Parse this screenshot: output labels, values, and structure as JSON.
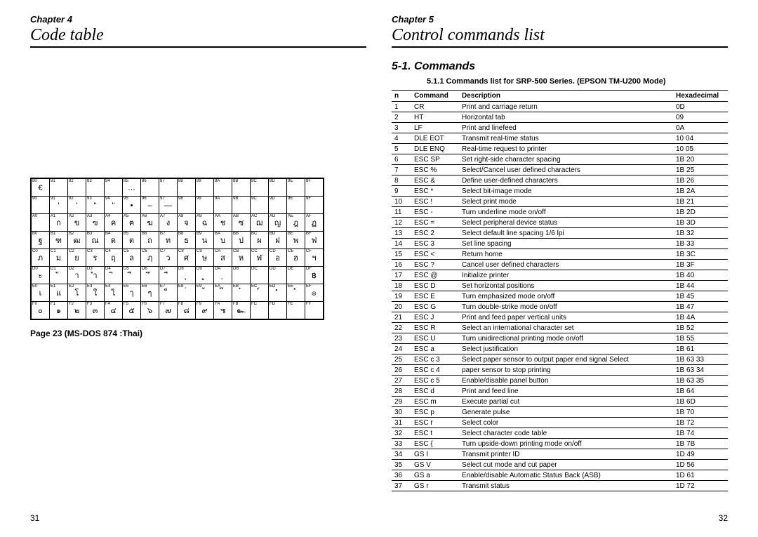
{
  "left": {
    "chapter": "Chapter 4",
    "title": "Code table",
    "caption": "Page 23 (MS-DOS 874 :Thai)",
    "page_num": "31",
    "code_rows": [
      [
        [
          "80",
          "€"
        ],
        [
          "81",
          ""
        ],
        [
          "82",
          ""
        ],
        [
          "83",
          ""
        ],
        [
          "84",
          ""
        ],
        [
          "85",
          "…"
        ],
        [
          "86",
          ""
        ],
        [
          "87",
          ""
        ],
        [
          "88",
          ""
        ],
        [
          "89",
          ""
        ],
        [
          "8A",
          ""
        ],
        [
          "8B",
          ""
        ],
        [
          "8C",
          ""
        ],
        [
          "8D",
          ""
        ],
        [
          "8E",
          ""
        ],
        [
          "8F",
          ""
        ]
      ],
      [
        [
          "90",
          ""
        ],
        [
          "91",
          "'"
        ],
        [
          "92",
          "'"
        ],
        [
          "93",
          "\""
        ],
        [
          "94",
          "\""
        ],
        [
          "95",
          "•"
        ],
        [
          "96",
          "–"
        ],
        [
          "97",
          "—"
        ],
        [
          "98",
          ""
        ],
        [
          "99",
          ""
        ],
        [
          "9A",
          ""
        ],
        [
          "9B",
          ""
        ],
        [
          "9C",
          ""
        ],
        [
          "9D",
          ""
        ],
        [
          "9E",
          ""
        ],
        [
          "9F",
          ""
        ]
      ],
      [
        [
          "A0",
          ""
        ],
        [
          "A1",
          "ก"
        ],
        [
          "A2",
          "ข"
        ],
        [
          "A3",
          "ฃ"
        ],
        [
          "A4",
          "ค"
        ],
        [
          "A5",
          "ฅ"
        ],
        [
          "A6",
          "ฆ"
        ],
        [
          "A7",
          "ง"
        ],
        [
          "A8",
          "จ"
        ],
        [
          "A9",
          "ฉ"
        ],
        [
          "AA",
          "ช"
        ],
        [
          "AB",
          "ซ"
        ],
        [
          "AC",
          "ฌ"
        ],
        [
          "AD",
          "ญ"
        ],
        [
          "AE",
          "ฎ"
        ],
        [
          "AF",
          "ฏ"
        ]
      ],
      [
        [
          "B0",
          "ฐ"
        ],
        [
          "B1",
          "ฑ"
        ],
        [
          "B2",
          "ฒ"
        ],
        [
          "B3",
          "ณ"
        ],
        [
          "B4",
          "ด"
        ],
        [
          "B5",
          "ต"
        ],
        [
          "B6",
          "ถ"
        ],
        [
          "B7",
          "ท"
        ],
        [
          "B8",
          "ธ"
        ],
        [
          "B9",
          "น"
        ],
        [
          "BA",
          "บ"
        ],
        [
          "BB",
          "ป"
        ],
        [
          "BC",
          "ผ"
        ],
        [
          "BD",
          "ฝ"
        ],
        [
          "BE",
          "พ"
        ],
        [
          "BF",
          "ฟ"
        ]
      ],
      [
        [
          "C0",
          "ภ"
        ],
        [
          "C1",
          "ม"
        ],
        [
          "C2",
          "ย"
        ],
        [
          "C3",
          "ร"
        ],
        [
          "C4",
          "ฤ"
        ],
        [
          "C5",
          "ล"
        ],
        [
          "C6",
          "ฦ"
        ],
        [
          "C7",
          "ว"
        ],
        [
          "C8",
          "ศ"
        ],
        [
          "C9",
          "ษ"
        ],
        [
          "CA",
          "ส"
        ],
        [
          "CB",
          "ห"
        ],
        [
          "CC",
          "ฬ"
        ],
        [
          "CD",
          "อ"
        ],
        [
          "CE",
          "ฮ"
        ],
        [
          "CF",
          "ฯ"
        ]
      ],
      [
        [
          "D0",
          "ะ"
        ],
        [
          "D1",
          " ั"
        ],
        [
          "D2",
          "า"
        ],
        [
          "D3",
          "ำ"
        ],
        [
          "D4",
          " ิ"
        ],
        [
          "D5",
          " ี"
        ],
        [
          "D6",
          " ึ"
        ],
        [
          "D7",
          " ื"
        ],
        [
          "D8",
          " ุ"
        ],
        [
          "D9",
          " ู"
        ],
        [
          "DA",
          " ฺ"
        ],
        [
          "DB",
          ""
        ],
        [
          "DC",
          ""
        ],
        [
          "DD",
          ""
        ],
        [
          "DE",
          ""
        ],
        [
          "DF",
          "฿"
        ]
      ],
      [
        [
          "E0",
          "เ"
        ],
        [
          "E1",
          "แ"
        ],
        [
          "E2",
          "โ"
        ],
        [
          "E3",
          "ใ"
        ],
        [
          "E4",
          "ไ"
        ],
        [
          "E5",
          "ๅ"
        ],
        [
          "E6",
          "ๆ"
        ],
        [
          "E7",
          " ็"
        ],
        [
          "E8",
          " ่"
        ],
        [
          "E9",
          " ้"
        ],
        [
          "EA",
          " ๊"
        ],
        [
          "EB",
          " ๋"
        ],
        [
          "EC",
          " ์"
        ],
        [
          "ED",
          " ํ"
        ],
        [
          "EE",
          " ๎"
        ],
        [
          "EF",
          "๏"
        ]
      ],
      [
        [
          "F0",
          "๐"
        ],
        [
          "F1",
          "๑"
        ],
        [
          "F2",
          "๒"
        ],
        [
          "F3",
          "๓"
        ],
        [
          "F4",
          "๔"
        ],
        [
          "F5",
          "๕"
        ],
        [
          "F6",
          "๖"
        ],
        [
          "F7",
          "๗"
        ],
        [
          "F8",
          "๘"
        ],
        [
          "F9",
          "๙"
        ],
        [
          "FA",
          "๚"
        ],
        [
          "FB",
          "๛"
        ],
        [
          "FC",
          ""
        ],
        [
          "FD",
          ""
        ],
        [
          "FE",
          ""
        ],
        [
          "FF",
          ""
        ]
      ]
    ]
  },
  "right": {
    "chapter": "Chapter 5",
    "title": "Control commands list",
    "section": "5-1. Commands",
    "subsection": "5.1.1 Commands list for SRP-500 Series. (EPSON TM-U200 Mode)",
    "page_num": "32",
    "headers": {
      "n": "n",
      "cmd": "Command",
      "desc": "Description",
      "hex": "Hexadecimal"
    },
    "rows": [
      {
        "n": "1",
        "cmd": "CR",
        "desc": "Print and carriage return",
        "hex": "0D"
      },
      {
        "n": "2",
        "cmd": "HT",
        "desc": "Horizontal tab",
        "hex": "09"
      },
      {
        "n": "3",
        "cmd": "LF",
        "desc": "Print and linefeed",
        "hex": "0A"
      },
      {
        "n": "4",
        "cmd": "DLE EOT",
        "desc": "Transmit real-time status",
        "hex": "10 04"
      },
      {
        "n": "5",
        "cmd": "DLE ENQ",
        "desc": "Real-time request to printer",
        "hex": "10 05"
      },
      {
        "n": "6",
        "cmd": "ESC SP",
        "desc": "Set right-side character spacing",
        "hex": "1B 20"
      },
      {
        "n": "7",
        "cmd": "ESC %",
        "desc": "Select/Cancel user defined characters",
        "hex": "1B 25"
      },
      {
        "n": "8",
        "cmd": "ESC &",
        "desc": "Define user-defined characters",
        "hex": "1B 26"
      },
      {
        "n": "9",
        "cmd": "ESC *",
        "desc": "Select bit-image mode",
        "hex": "1B 2A"
      },
      {
        "n": "10",
        "cmd": "ESC !",
        "desc": "Select print mode",
        "hex": "1B 21"
      },
      {
        "n": "11",
        "cmd": "ESC -",
        "desc": "Turn underline mode on/off",
        "hex": "1B 2D"
      },
      {
        "n": "12",
        "cmd": "ESC =",
        "desc": "Select peripheral device status",
        "hex": "1B 3D"
      },
      {
        "n": "13",
        "cmd": "ESC 2",
        "desc": "Select default line spacing 1/6 lpi",
        "hex": "1B 32"
      },
      {
        "n": "14",
        "cmd": "ESC 3",
        "desc": "Set line spacing",
        "hex": "1B 33"
      },
      {
        "n": "15",
        "cmd": "ESC <",
        "desc": "Return home",
        "hex": "1B 3C"
      },
      {
        "n": "16",
        "cmd": "ESC ?",
        "desc": "Cancel user defined characters",
        "hex": "1B 3F"
      },
      {
        "n": "17",
        "cmd": "ESC @",
        "desc": "Initialize printer",
        "hex": "1B 40"
      },
      {
        "n": "18",
        "cmd": "ESC D",
        "desc": "Set horizontal positions",
        "hex": "1B 44"
      },
      {
        "n": "19",
        "cmd": "ESC E",
        "desc": "Turn emphasized mode on/off",
        "hex": "1B 45"
      },
      {
        "n": "20",
        "cmd": "ESC G",
        "desc": "Turn double-strike mode on/off",
        "hex": "1B 47"
      },
      {
        "n": "21",
        "cmd": "ESC J",
        "desc": "Print and feed paper <n> vertical units",
        "hex": "1B 4A"
      },
      {
        "n": "22",
        "cmd": "ESC R",
        "desc": "Select an international character set",
        "hex": "1B 52"
      },
      {
        "n": "23",
        "cmd": "ESC U",
        "desc": "Turn unidirectional printing mode on/off",
        "hex": "1B 55"
      },
      {
        "n": "24",
        "cmd": "ESC a",
        "desc": "Select justification",
        "hex": "1B 61"
      },
      {
        "n": "25",
        "cmd": "ESC c 3",
        "desc": "Select paper sensor to output paper end signal Select",
        "hex": "1B 63 33"
      },
      {
        "n": "26",
        "cmd": "ESC c 4",
        "desc": "paper sensor to stop printing",
        "hex": "1B 63 34"
      },
      {
        "n": "27",
        "cmd": "ESC c 5",
        "desc": "Enable/disable panel button",
        "hex": "1B 63 35"
      },
      {
        "n": "28",
        "cmd": "ESC d",
        "desc": "Print and feed <n> line",
        "hex": "1B 64"
      },
      {
        "n": "29",
        "cmd": "ESC m",
        "desc": "Execute partial cut",
        "hex": "1B 6D"
      },
      {
        "n": "30",
        "cmd": "ESC p",
        "desc": "Generate pulse",
        "hex": "1B 70"
      },
      {
        "n": "31",
        "cmd": "ESC r",
        "desc": "Select color",
        "hex": "1B 72"
      },
      {
        "n": "32",
        "cmd": "ESC t",
        "desc": "Select character code table",
        "hex": "1B 74"
      },
      {
        "n": "33",
        "cmd": "ESC {",
        "desc": "Turn upside-down printing mode on/off",
        "hex": "1B 7B"
      },
      {
        "n": "34",
        "cmd": "GS I",
        "desc": "Transmit printer ID",
        "hex": "1D 49"
      },
      {
        "n": "35",
        "cmd": "GS V",
        "desc": "Select cut mode and cut paper",
        "hex": "1D 56"
      },
      {
        "n": "36",
        "cmd": "GS a",
        "desc": "Enable/disable Automatic Status Back (ASB)",
        "hex": "1D 61"
      },
      {
        "n": "37",
        "cmd": "GS r",
        "desc": "Transmit status",
        "hex": "1D 72"
      }
    ]
  }
}
